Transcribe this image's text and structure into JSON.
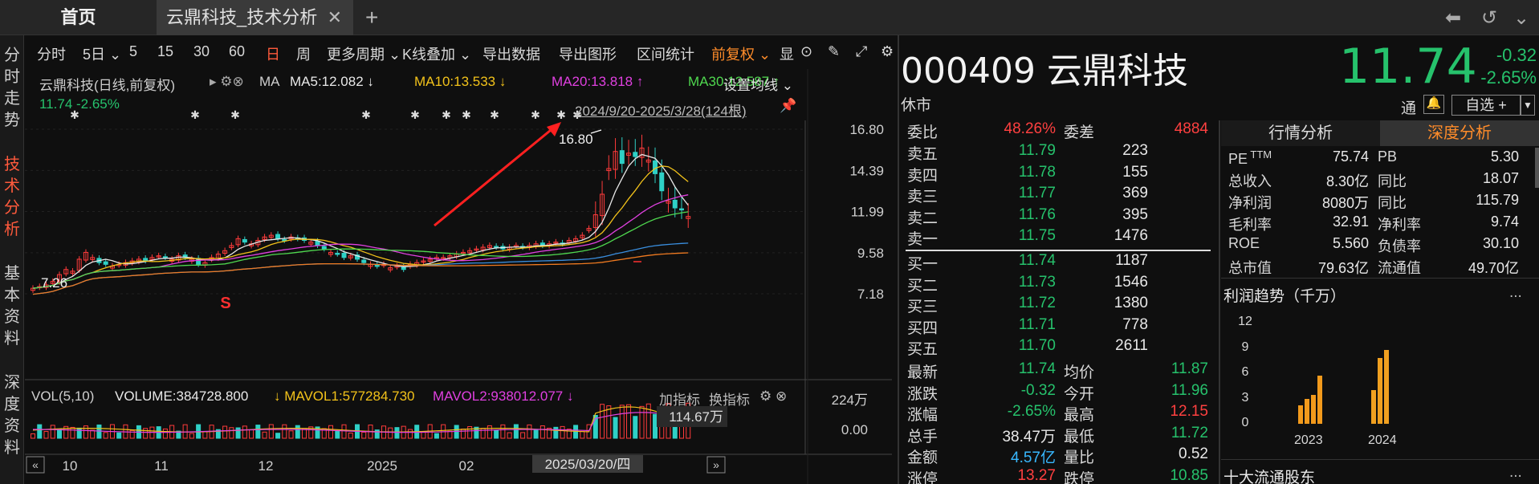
{
  "tabs": {
    "home": "首页",
    "active": "云鼎科技_技术分析",
    "close": "✕",
    "add": "+"
  },
  "left_nav": [
    {
      "label": [
        "分",
        "时",
        "走",
        "势"
      ],
      "active": false
    },
    {
      "label": [
        "技",
        "术",
        "分",
        "析"
      ],
      "active": true
    },
    {
      "label": [
        "基",
        "本",
        "资",
        "料"
      ],
      "active": false
    },
    {
      "label": [
        "深",
        "度",
        "资",
        "料"
      ],
      "active": false
    }
  ],
  "toolbar": {
    "items": [
      "分时",
      "5日",
      "5",
      "15",
      "30",
      "60",
      "日",
      "周",
      "更多周期",
      "K线叠加",
      "导出数据",
      "导出图形",
      "区间统计",
      "前复权",
      "显"
    ],
    "active_item": "日",
    "setting_ma": "设置均线"
  },
  "chart_header": {
    "stock_label": "云鼎科技(日线,前复权)",
    "ma_label": "MA",
    "ma5": "MA5:12.082",
    "ma10": "MA10:13.533",
    "ma20": "MA20:13.818",
    "ma30": "MA30:12.587",
    "current": "11.74",
    "current_pct": "-2.65%",
    "range": "2024/9/20-2025/3/28(124根)"
  },
  "chart_data": {
    "type": "candlestick",
    "y_ticks": [
      "16.80",
      "14.39",
      "11.99",
      "9.58",
      "7.18"
    ],
    "x_ticks": [
      "10",
      "11",
      "12",
      "2025",
      "02"
    ],
    "high_label": "16.80",
    "low_label": "7.26",
    "cursor_date": "2025/03/20/四",
    "ylim": [
      7.18,
      16.8
    ],
    "close": [
      7.5,
      7.6,
      7.7,
      7.9,
      8.3,
      8.6,
      8.5,
      9.2,
      9.6,
      9.3,
      9.0,
      8.9,
      8.8,
      8.9,
      9.0,
      9.1,
      9.2,
      9.1,
      9.3,
      9.4,
      9.3,
      9.2,
      9.4,
      9.3,
      9.2,
      8.9,
      9.0,
      9.3,
      9.5,
      9.7,
      10.0,
      10.4,
      10.2,
      10.1,
      10.3,
      10.5,
      10.6,
      10.4,
      10.3,
      10.5,
      10.4,
      10.3,
      10.2,
      10.0,
      9.8,
      9.6,
      9.5,
      9.3,
      9.4,
      9.2,
      9.0,
      8.9,
      8.8,
      8.9,
      8.7,
      8.8,
      8.6,
      8.9,
      9.0,
      9.1,
      9.2,
      9.3,
      9.3,
      9.4,
      9.5,
      9.6,
      9.7,
      9.8,
      9.9,
      10.0,
      9.9,
      9.8,
      9.9,
      10.0,
      9.9,
      10.0,
      10.1,
      10.0,
      10.1,
      10.2,
      10.1,
      10.3,
      10.4,
      10.6,
      11.0,
      11.8,
      13.0,
      14.5,
      15.5,
      14.8,
      15.4,
      15.2,
      15.7,
      15.0,
      14.2,
      13.2,
      12.6,
      12.2,
      12.1,
      11.7
    ]
  },
  "volume_panel": {
    "title": "VOL(5,10)",
    "volume": "VOLUME:384728.800",
    "mavol1": "MAVOL1:577284.730",
    "mavol2": "MAVOL2:938012.077",
    "add_indicator": "加指标",
    "change_indicator": "换指标",
    "y_top": "224万",
    "y_bottom": "0.00",
    "cursor_value": "114.67万"
  },
  "quote": {
    "code": "000409",
    "name": "云鼎科技",
    "price": "11.74",
    "change": "-0.32",
    "change_pct": "-2.65%",
    "status": "休市",
    "tong": "通",
    "watchlist": "自选 +",
    "weibi_label": "委比",
    "weibi": "48.26%",
    "weicha_label": "委差",
    "weicha": "4884",
    "asks": [
      {
        "label": "卖五",
        "price": "11.79",
        "vol": "223"
      },
      {
        "label": "卖四",
        "price": "11.78",
        "vol": "155"
      },
      {
        "label": "卖三",
        "price": "11.77",
        "vol": "369"
      },
      {
        "label": "卖二",
        "price": "11.76",
        "vol": "395"
      },
      {
        "label": "卖一",
        "price": "11.75",
        "vol": "1476"
      }
    ],
    "bids": [
      {
        "label": "买一",
        "price": "11.74",
        "vol": "1187"
      },
      {
        "label": "买二",
        "price": "11.73",
        "vol": "1546"
      },
      {
        "label": "买三",
        "price": "11.72",
        "vol": "1380"
      },
      {
        "label": "买四",
        "price": "11.71",
        "vol": "778"
      },
      {
        "label": "买五",
        "price": "11.70",
        "vol": "2611"
      }
    ],
    "stats": [
      {
        "l1": "最新",
        "v1": "11.74",
        "c1": "green",
        "l2": "均价",
        "v2": "11.87",
        "c2": "green"
      },
      {
        "l1": "涨跌",
        "v1": "-0.32",
        "c1": "green",
        "l2": "今开",
        "v2": "11.96",
        "c2": "green"
      },
      {
        "l1": "涨幅",
        "v1": "-2.65%",
        "c1": "green",
        "l2": "最高",
        "v2": "12.15",
        "c2": "red2"
      },
      {
        "l1": "总手",
        "v1": "38.47万",
        "c1": "white",
        "l2": "最低",
        "v2": "11.72",
        "c2": "green"
      },
      {
        "l1": "金额",
        "v1": "4.57亿",
        "c1": "blue",
        "l2": "量比",
        "v2": "0.52",
        "c2": "white"
      },
      {
        "l1": "涨停",
        "v1": "13.27",
        "c1": "red2",
        "l2": "跌停",
        "v2": "10.85",
        "c2": "green"
      }
    ]
  },
  "analysis": {
    "tab1": "行情分析",
    "tab2": "深度分析",
    "metrics": [
      {
        "l1": "PE",
        "sup": "TTM",
        "v1": "75.74",
        "l2": "PB",
        "v2": "5.30"
      },
      {
        "l1": "总收入",
        "v1": "8.30亿",
        "l2": "同比",
        "v2": "18.07"
      },
      {
        "l1": "净利润",
        "v1": "8080万",
        "l2": "同比",
        "v2": "115.79"
      },
      {
        "l1": "毛利率",
        "v1": "32.91",
        "l2": "净利率",
        "v2": "9.74"
      },
      {
        "l1": "ROE",
        "v1": "5.560",
        "l2": "负债率",
        "v2": "30.10"
      },
      {
        "l1": "总市值",
        "v1": "79.63亿",
        "l2": "流通值",
        "v2": "49.70亿"
      }
    ],
    "profit_title": "利润趋势（千万）",
    "profit_more": "...",
    "profit_y": [
      "12",
      "9",
      "6",
      "3",
      "0"
    ],
    "profit_years": [
      "2023",
      "2024"
    ],
    "profit_2023": [
      2.2,
      3.0,
      3.4,
      5.7
    ],
    "profit_2024": [
      4.0,
      7.8,
      8.8
    ],
    "holders_title": "十大流通股东",
    "holders_more": "..."
  }
}
